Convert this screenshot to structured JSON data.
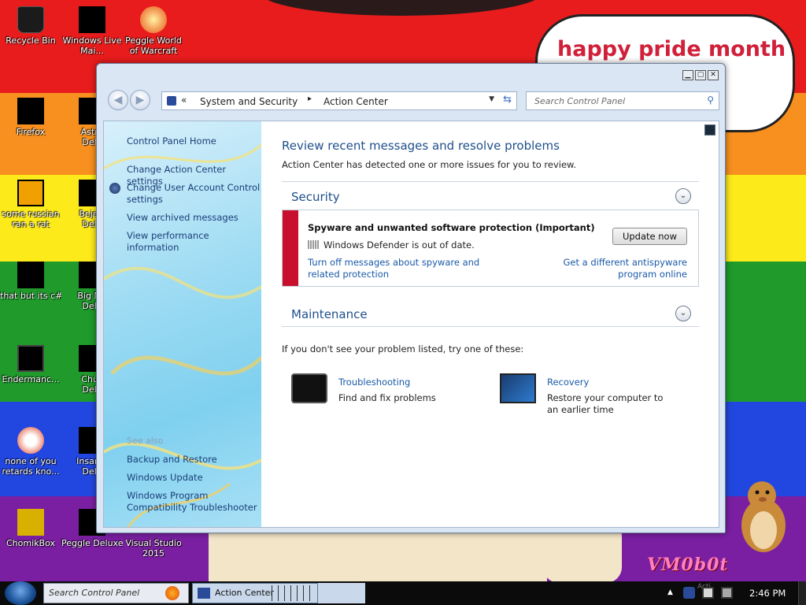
{
  "colors": {
    "stripe_red": "#e81c1c",
    "stripe_orange": "#f7901e",
    "stripe_yellow": "#fdea1a",
    "stripe_green": "#1f9a2b",
    "stripe_blue": "#2247e0",
    "stripe_purple": "#7a1fa2",
    "link_blue": "#1a5aa8",
    "heading_blue": "#1e4f8c",
    "alert_red": "#c8102e"
  },
  "desktop": {
    "bubble_text": "happy pride month",
    "watermark": "VM0b0t",
    "icons": [
      {
        "label": "Recycle Bin",
        "icon": "recycle-bin-icon"
      },
      {
        "label": "Windows Live",
        "label2": "Mai...",
        "icon": "windows-live-mail-icon"
      },
      {
        "label": "Peggle World",
        "label2": "of Warcraft",
        "icon": "peggle-icon"
      },
      {
        "label": "Firefox",
        "icon": "firefox-icon"
      },
      {
        "label": "Astro",
        "label2": "Delu",
        "icon": "astro-icon"
      },
      {
        "label": "some russian",
        "label2": "ran a rat",
        "icon": "app-icon"
      },
      {
        "label": "Bejew",
        "label2": "Delu",
        "icon": "bejeweled-icon"
      },
      {
        "label": "that but its c#",
        "icon": "folder-stack-icon"
      },
      {
        "label": "Big Mo",
        "label2": "Delu",
        "icon": "game-icon"
      },
      {
        "label": "Endermanc...",
        "icon": "window-icon"
      },
      {
        "label": "Chuz",
        "label2": "Delu",
        "icon": "game-icon"
      },
      {
        "label": "none of you",
        "label2": "retards kno...",
        "icon": "firefox-icon"
      },
      {
        "label": "Insaniq",
        "label2": "Delu",
        "icon": "game-icon"
      },
      {
        "label": "ChomikBox",
        "icon": "chomikbox-icon"
      },
      {
        "label": "Peggle Deluxe",
        "icon": "peggle-icon"
      },
      {
        "label": "Visual Studio",
        "label2": "2015",
        "icon": "visual-studio-icon"
      }
    ]
  },
  "window": {
    "address": {
      "crumb1": "System and Security",
      "crumb2": "Action Center"
    },
    "search_placeholder": "Search Control Panel",
    "left": {
      "home": "Control Panel Home",
      "links": [
        "Change Action Center settings",
        "Change User Account Control settings",
        "View archived messages",
        "View performance information"
      ],
      "see_also": "See also",
      "see_also_links": [
        "Backup and Restore",
        "Windows Update",
        "Windows Program Compatibility Troubleshooter"
      ]
    },
    "main": {
      "heading": "Review recent messages and resolve problems",
      "subheading": "Action Center has detected one or more issues for you to review.",
      "security_title": "Security",
      "alert_title": "Spyware and unwanted software protection  (Important)",
      "alert_desc": "Windows Defender is out of date.",
      "update_button": "Update now",
      "alert_link1": "Turn off messages about spyware and related protection",
      "alert_link2": "Get a different antispyware program online",
      "maintenance_title": "Maintenance",
      "hint": "If you don't see your problem listed, try one of these:",
      "tools": [
        {
          "name": "Troubleshooting",
          "desc": "Find and fix problems"
        },
        {
          "name": "Recovery",
          "desc": "Restore your computer to an earlier time"
        }
      ]
    }
  },
  "taskbar": {
    "search_placeholder": "Search Control Panel",
    "task_label": "Action Center",
    "tray_label": "Acti",
    "clock": "2:46 PM"
  }
}
